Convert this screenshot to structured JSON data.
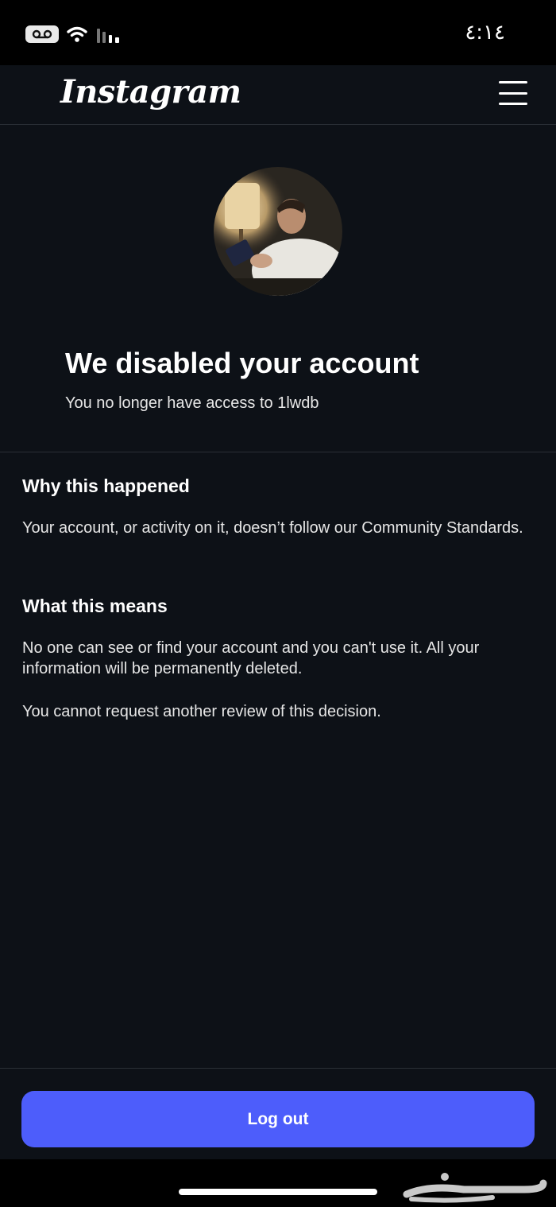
{
  "status_bar": {
    "time": "٤:١٤"
  },
  "header": {
    "logo": "Instagram"
  },
  "account": {
    "title": "We disabled your account",
    "subtitle": "You no longer have access to 1lwdb"
  },
  "sections": [
    {
      "heading": "Why this happened",
      "paragraphs": [
        "Your account, or activity on it, doesn’t follow our Community Standards."
      ]
    },
    {
      "heading": "What this means",
      "paragraphs": [
        "No one can see or find your account and you can't use it. All your information will be permanently deleted.",
        "You cannot request another review of this decision."
      ]
    }
  ],
  "logout_label": "Log out",
  "watermark": "حراج",
  "colors": {
    "background": "#0d1117",
    "button": "#4d5dfb"
  }
}
